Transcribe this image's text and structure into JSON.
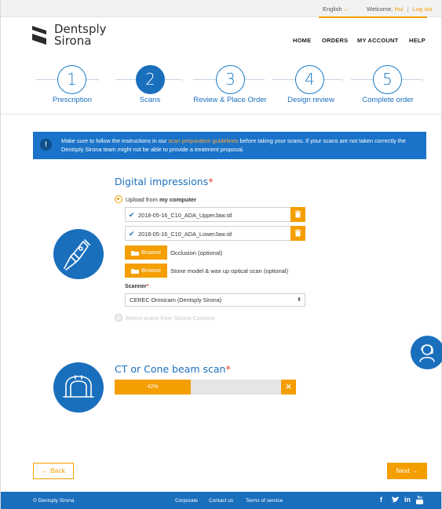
{
  "topbar": {
    "language": "English",
    "welcome_prefix": "Welcome,",
    "user_name": "Hui",
    "separator": "|",
    "logout": "Log out"
  },
  "brand": {
    "line1": "Dentsply",
    "line2": "Sirona"
  },
  "nav": {
    "home": "HOME",
    "orders": "ORDERS",
    "account": "MY ACCOUNT",
    "help": "HELP"
  },
  "steps": [
    {
      "number": "1",
      "label": "Prescription",
      "active": false
    },
    {
      "number": "2",
      "label": "Scans",
      "active": true
    },
    {
      "number": "3",
      "label": "Review & Place Order",
      "active": false
    },
    {
      "number": "4",
      "label": "Design review",
      "active": false
    },
    {
      "number": "5",
      "label": "Complete order",
      "active": false
    }
  ],
  "banner": {
    "icon": "!",
    "text_before": "Make sure to follow the instructions in our ",
    "link": "scan preparation guidelines",
    "text_after": " before taking your scans. If your scans are not taken correctly the Dentsply Sirona team might not be able to provide a treatment proposal."
  },
  "digital": {
    "title": "Digital impressions",
    "required_mark": "*",
    "upload_option_prefix": "Upload from ",
    "upload_option_bold": "my computer",
    "files": [
      "2018-05-16_C10_ADA_UpperJaw.stl",
      "2018-05-16_C10_ADA_LowerJaw.stl"
    ],
    "browse_label": "Browse",
    "occlusion_label": "Occlusion (optional)",
    "stone_label": "Stone model & wax up optical scan (optional)",
    "scanner_label": "Scanner",
    "scanner_value": "CEREC Omnicam (Dentsply Sirona)",
    "connect_option": "Select scans from Sirona Connect"
  },
  "ct": {
    "title": "CT or Cone beam scan",
    "required_mark": "*",
    "progress_text": "42%",
    "progress_value": 0.42
  },
  "actions": {
    "back": "← Back",
    "next": "Next →"
  },
  "footer": {
    "copyright": "© Dentsply Sirona",
    "corporate": "Corporate",
    "contact": "Contact us",
    "terms": "Terms of service",
    "social": [
      "f",
      "t",
      "in",
      "yt"
    ]
  },
  "colors": {
    "primary_blue": "#1a6fbd",
    "accent_orange": "#f49e00",
    "required_red": "#e2432b"
  }
}
